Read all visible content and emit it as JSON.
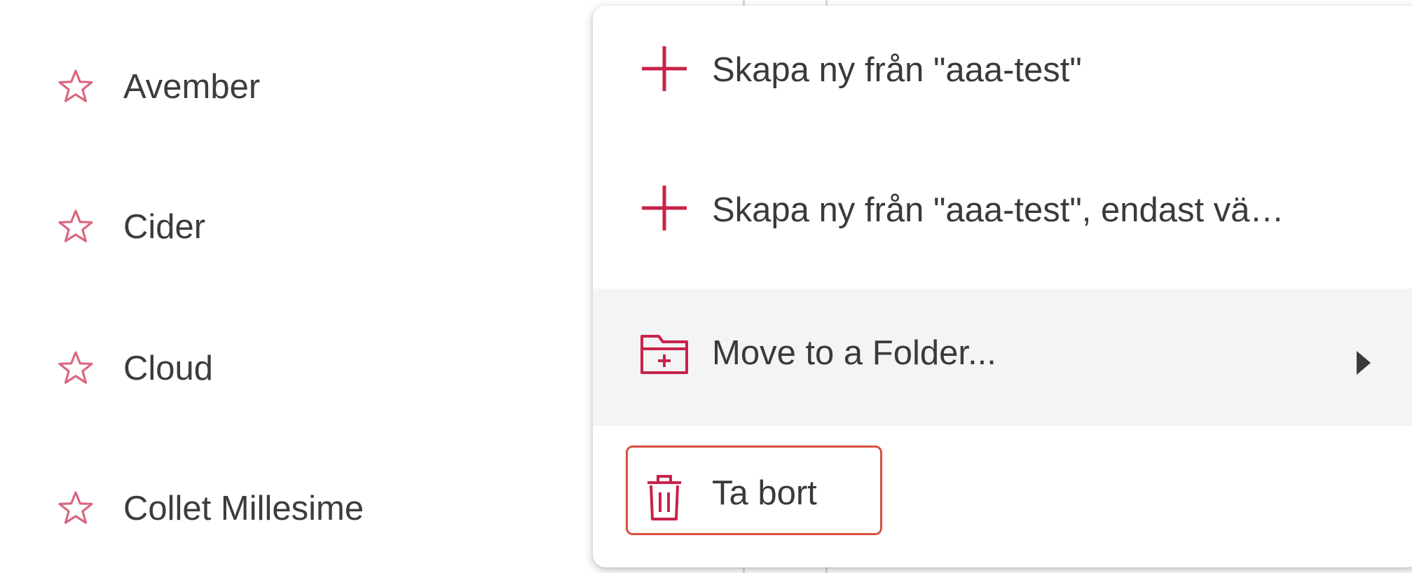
{
  "favorites": {
    "items": [
      {
        "label": "Avember",
        "icon": "star-outline-icon"
      },
      {
        "label": "Cider",
        "icon": "star-outline-icon"
      },
      {
        "label": "Cloud",
        "icon": "star-outline-icon"
      },
      {
        "label": "Collet Millesime",
        "icon": "star-outline-icon"
      }
    ]
  },
  "context_menu": {
    "items": [
      {
        "label": "Skapa ny från \"aaa-test\"",
        "icon": "plus-icon"
      },
      {
        "label": "Skapa ny från \"aaa-test\", endast vä…",
        "icon": "plus-icon"
      },
      {
        "label": "Move to a Folder...",
        "icon": "folder-plus-icon",
        "submenu_icon": "caret-right-icon",
        "highlighted": true
      },
      {
        "label": "Ta bort",
        "icon": "trash-icon",
        "focused": true
      }
    ]
  },
  "colors": {
    "accent": "#c8234a",
    "star": "#d9667f",
    "focus_ring": "#d9503f",
    "hover_bg": "#f4f4f4"
  }
}
